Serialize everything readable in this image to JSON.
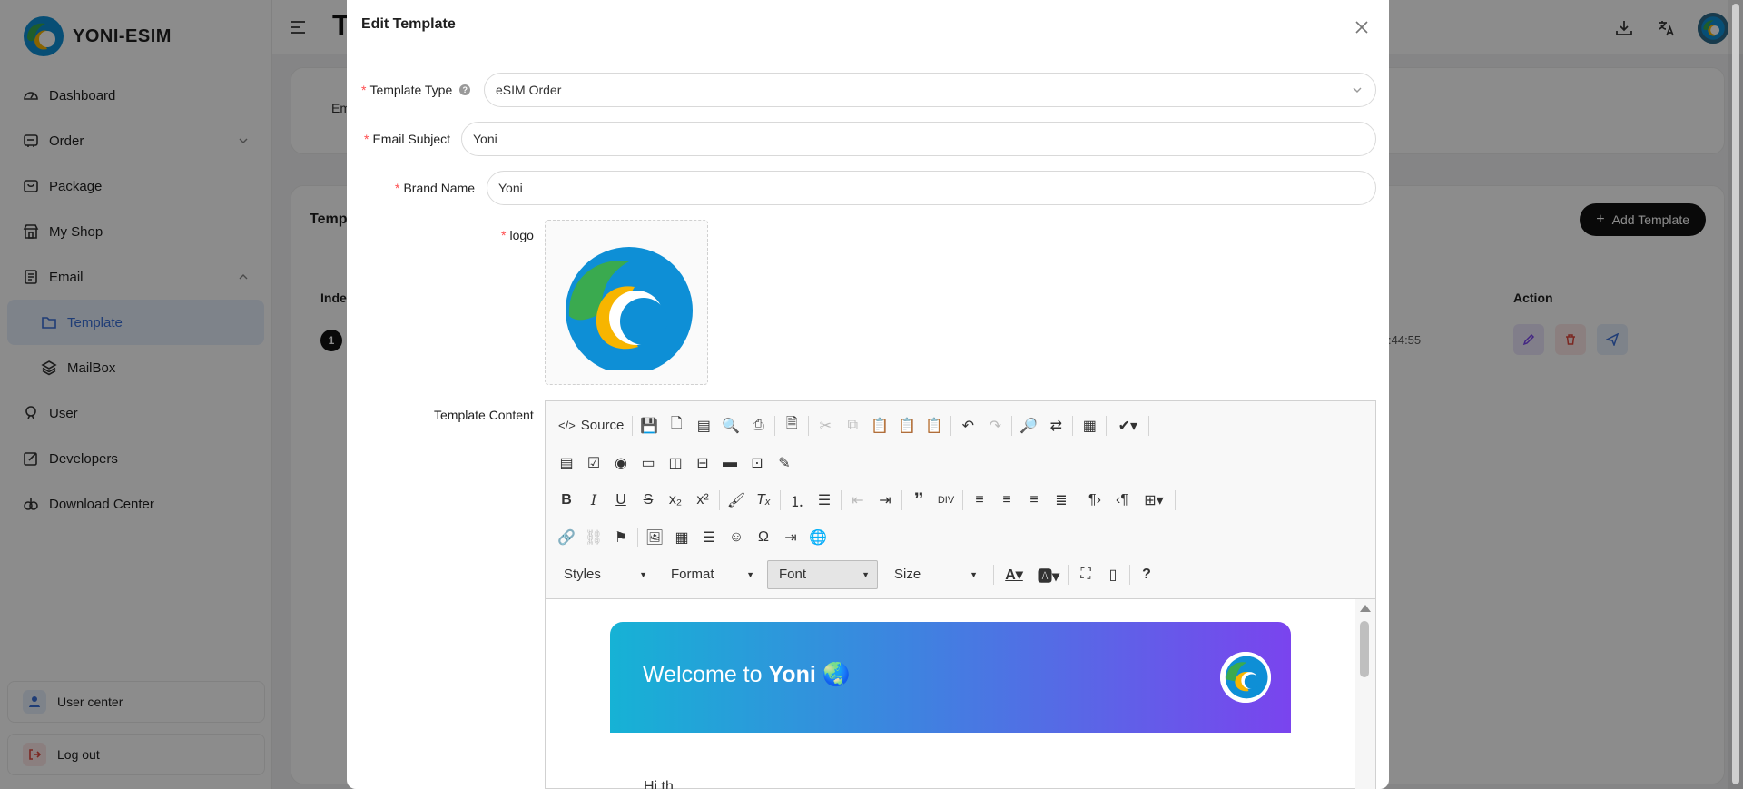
{
  "app": {
    "brand": "YONI-ESIM",
    "page_title": "T"
  },
  "sidebar": {
    "items": [
      {
        "label": "Dashboard",
        "icon": "dashboard-icon"
      },
      {
        "label": "Order",
        "icon": "order-icon",
        "expandable": true
      },
      {
        "label": "Package",
        "icon": "package-icon"
      },
      {
        "label": "My Shop",
        "icon": "shop-icon"
      },
      {
        "label": "Email",
        "icon": "email-icon",
        "expanded": true
      },
      {
        "label": "Template",
        "icon": "folder-icon",
        "active": true
      },
      {
        "label": "MailBox",
        "icon": "layers-icon"
      },
      {
        "label": "User",
        "icon": "user-icon"
      },
      {
        "label": "Developers",
        "icon": "edit-icon"
      },
      {
        "label": "Download Center",
        "icon": "download-center-icon"
      }
    ],
    "user_center": "User center",
    "logout": "Log out"
  },
  "background": {
    "filter_label": "Em",
    "list_title": "Temp",
    "add_button": "Add Template",
    "col_index": "Inde",
    "col_action": "Action",
    "row_index": "1",
    "row_time": ":44:55"
  },
  "modal": {
    "title": "Edit Template",
    "fields": {
      "template_type_label": "Template Type",
      "template_type_value": "eSIM Order",
      "email_subject_label": "Email Subject",
      "email_subject_value": "Yoni",
      "brand_name_label": "Brand Name",
      "brand_name_value": "Yoni",
      "logo_label": "logo",
      "content_label": "Template Content"
    },
    "editor": {
      "source_label": "Source",
      "styles_label": "Styles",
      "format_label": "Format",
      "font_label": "Font",
      "size_label": "Size",
      "banner_prefix": "Welcome to ",
      "banner_brand": "Yoni",
      "banner_emoji": "🌏",
      "greeting": "Hi th"
    }
  },
  "colors": {
    "accent": "#3a6fd8",
    "active_bg": "#e6eefc",
    "required": "#ff4d4f",
    "banner_start": "#16b2d5",
    "banner_end": "#7a44ee",
    "logo_blue": "#0e8fd6",
    "logo_green": "#3aaa4f",
    "logo_yellow": "#f7b500"
  }
}
